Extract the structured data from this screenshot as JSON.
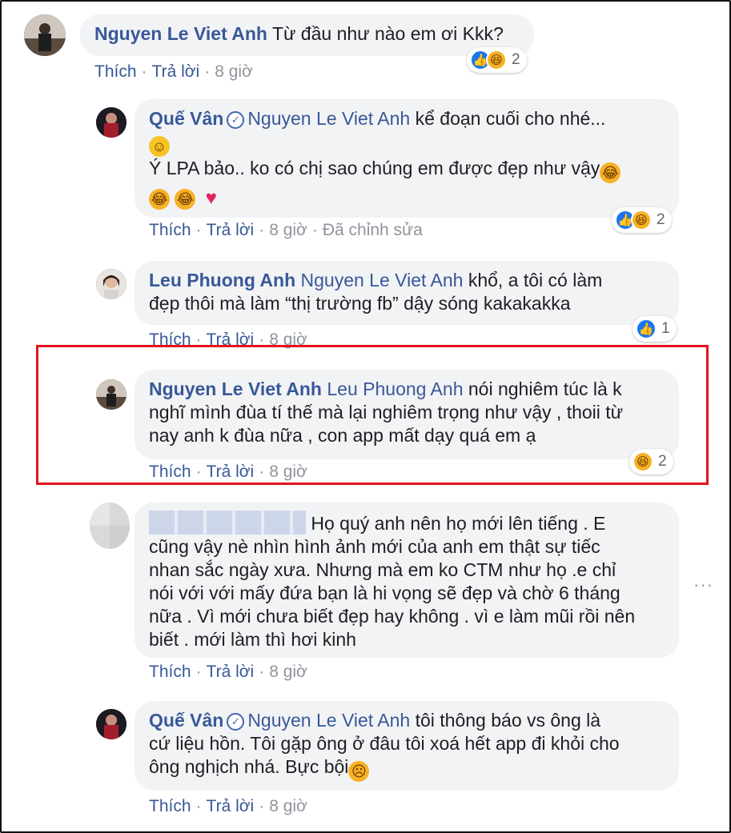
{
  "comments": [
    {
      "author": "Nguyen Le Viet Anh",
      "text": "Từ đầu như nào em ơi Kkk?",
      "actions": {
        "like": "Thích",
        "reply": "Trả lời",
        "time": "8 giờ"
      },
      "reactions": {
        "count": "2",
        "types": [
          "like",
          "haha"
        ]
      }
    },
    {
      "author": "Quế Vân",
      "verified": true,
      "mention": "Nguyen Le Viet Anh",
      "text_line1": "kể đoạn cuối cho nhé...",
      "text_line2": "Ý LPA bảo.. ko có chị sao chúng em được đẹp như vậy",
      "actions": {
        "like": "Thích",
        "reply": "Trả lời",
        "time": "8 giờ",
        "edited": "Đã chỉnh sửa"
      },
      "reactions": {
        "count": "2",
        "types": [
          "like",
          "haha"
        ]
      }
    },
    {
      "author": "Leu Phuong Anh",
      "mention": "Nguyen Le Viet Anh",
      "text_line1": "khổ, a tôi có làm",
      "text_line2": "đẹp thôi mà làm “thị trường fb” dậy sóng kakakakka",
      "actions": {
        "like": "Thích",
        "reply": "Trả lời",
        "time": "8 giờ"
      },
      "reactions": {
        "count": "1",
        "types": [
          "like"
        ]
      }
    },
    {
      "author": "Nguyen Le Viet Anh",
      "mention": "Leu Phuong Anh",
      "text_line1": "nói nghiêm túc là k",
      "text_line2": "nghĩ mình đùa tí thế mà lại nghiêm trọng như vậy , thoii từ",
      "text_line3": "nay anh k đùa nữa , con app mất dạy quá em ạ",
      "actions": {
        "like": "Thích",
        "reply": "Trả lời",
        "time": "8 giờ"
      },
      "reactions": {
        "count": "2",
        "types": [
          "haha"
        ]
      }
    },
    {
      "author": "",
      "text_line1": "Họ quý anh nên họ mới lên tiếng . E",
      "text_line2": "cũng vậy nè nhìn hình ảnh mới của anh em thật sự tiếc",
      "text_line3": "nhan sắc ngày xưa. Nhưng mà em ko CTM như họ .e chỉ",
      "text_line4": "nói với với mấy đứa bạn là hi vọng sẽ đẹp và chờ 6 tháng",
      "text_line5": "nữa . Vì mới chưa biết đẹp hay không . vì e làm mũi rồi nên",
      "text_line6": "biết . mới làm thì hơi kinh",
      "actions": {
        "like": "Thích",
        "reply": "Trả lời",
        "time": "8 giờ"
      },
      "more": "···"
    },
    {
      "author": "Quế Vân",
      "verified": true,
      "mention": "Nguyen Le Viet Anh",
      "text_line1": "tôi thông báo vs ông là",
      "text_line2": "cứ liệu hồn. Tôi gặp ông ở đâu tôi xoá hết app đi khỏi cho",
      "text_line3": "ông nghịch nhá. Bực bội",
      "actions": {
        "like": "Thích",
        "reply": "Trả lời",
        "time": "8 giờ"
      }
    }
  ],
  "colors": {
    "link": "#385898",
    "muted": "#90949c",
    "bubble": "#f2f3f5",
    "highlight": "#e3141c",
    "like": "#1877f2"
  }
}
